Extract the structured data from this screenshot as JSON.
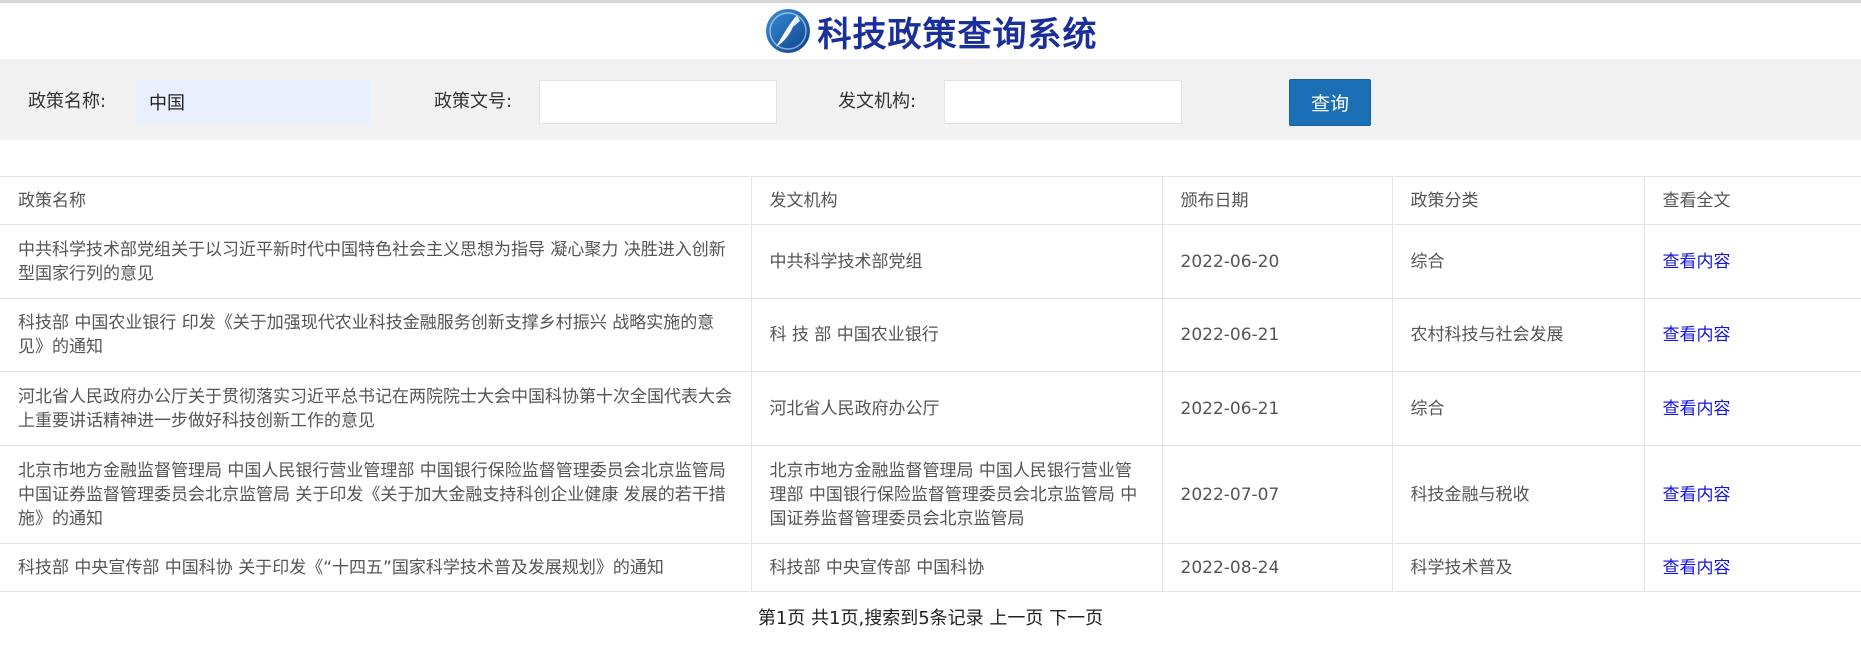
{
  "app": {
    "title": "科技政策查询系统",
    "logo_icon": "compass-logo-icon",
    "brand_color": "#1a2f9a"
  },
  "search": {
    "name_label": "政策名称:",
    "name_value": "中国",
    "doc_no_label": "政策文号:",
    "doc_no_value": "",
    "org_label": "发文机构:",
    "org_value": "",
    "query_button": "查询",
    "button_color": "#1a6fb5"
  },
  "table": {
    "headers": [
      "政策名称",
      "发文机构",
      "颁布日期",
      "政策分类",
      "查看全文"
    ],
    "rows": [
      {
        "name": "中共科学技术部党组关于以习近平新时代中国特色社会主义思想为指导 凝心聚力 决胜进入创新型国家行列的意见",
        "org": "中共科学技术部党组",
        "date": "2022-06-20",
        "category": "综合",
        "link": "查看内容"
      },
      {
        "name": "科技部 中国农业银行 印发《关于加强现代农业科技金融服务创新支撑乡村振兴 战略实施的意见》的通知",
        "org": "科 技 部 中国农业银行",
        "date": "2022-06-21",
        "category": "农村科技与社会发展",
        "link": "查看内容"
      },
      {
        "name": "河北省人民政府办公厅关于贯彻落实习近平总书记在两院院士大会中国科协第十次全国代表大会上重要讲话精神进一步做好科技创新工作的意见",
        "org": "河北省人民政府办公厅",
        "date": "2022-06-21",
        "category": "综合",
        "link": "查看内容"
      },
      {
        "name": "北京市地方金融监督管理局 中国人民银行营业管理部 中国银行保险监督管理委员会北京监管局 中国证券监督管理委员会北京监管局 关于印发《关于加大金融支持科创企业健康 发展的若干措施》的通知",
        "org": "北京市地方金融监督管理局 中国人民银行营业管理部 中国银行保险监督管理委员会北京监管局 中国证券监督管理委员会北京监管局",
        "date": "2022-07-07",
        "category": "科技金融与税收",
        "link": "查看内容"
      },
      {
        "name": "科技部 中央宣传部 中国科协 关于印发《“十四五”国家科学技术普及发展规划》的通知",
        "org": "科技部 中央宣传部 中国科协",
        "date": "2022-08-24",
        "category": "科学技术普及",
        "link": "查看内容"
      }
    ]
  },
  "pagination": {
    "summary": "第1页 共1页,搜索到5条记录",
    "prev": "上一页",
    "next": "下一页"
  }
}
